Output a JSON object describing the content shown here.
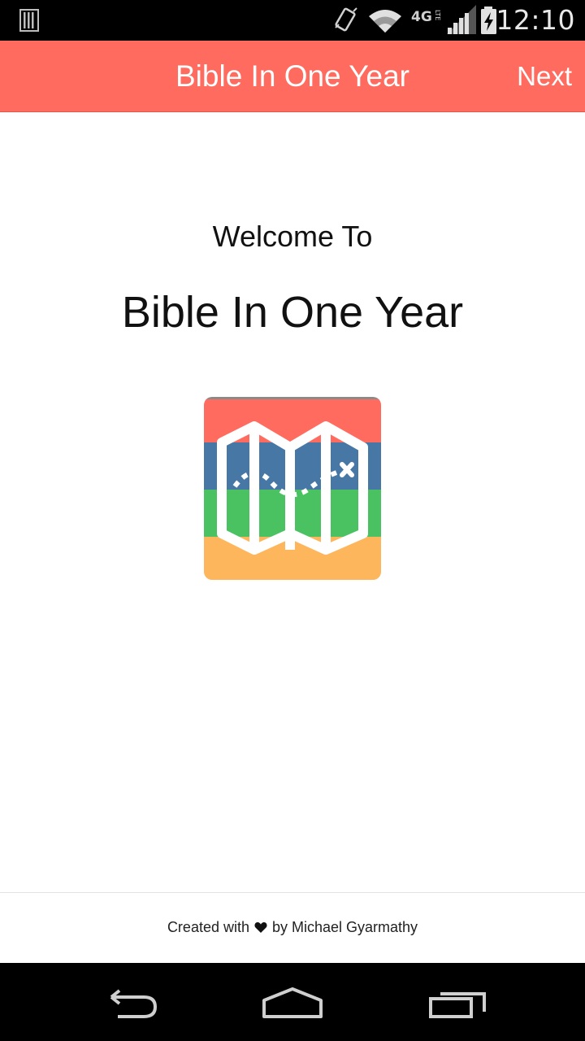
{
  "status_bar": {
    "time": "12:10",
    "icons": [
      "notification-icon",
      "vibrate-icon",
      "wifi-icon",
      "4g-lte-icon",
      "signal-icon",
      "battery-charging-icon"
    ]
  },
  "app_bar": {
    "title": "Bible In One Year",
    "next_label": "Next",
    "color": "#ff6b5e"
  },
  "main": {
    "welcome": "Welcome To",
    "headline": "Bible In One Year",
    "icon": "map-route-icon",
    "icon_colors": [
      "#ff6b5e",
      "#4677a5",
      "#4ac262",
      "#fdb65c"
    ]
  },
  "footer": {
    "created_with": "Created with",
    "by_text": "by Michael Gyarmathy"
  },
  "nav_bar": {
    "buttons": [
      "back-icon",
      "home-icon",
      "recents-icon"
    ]
  }
}
